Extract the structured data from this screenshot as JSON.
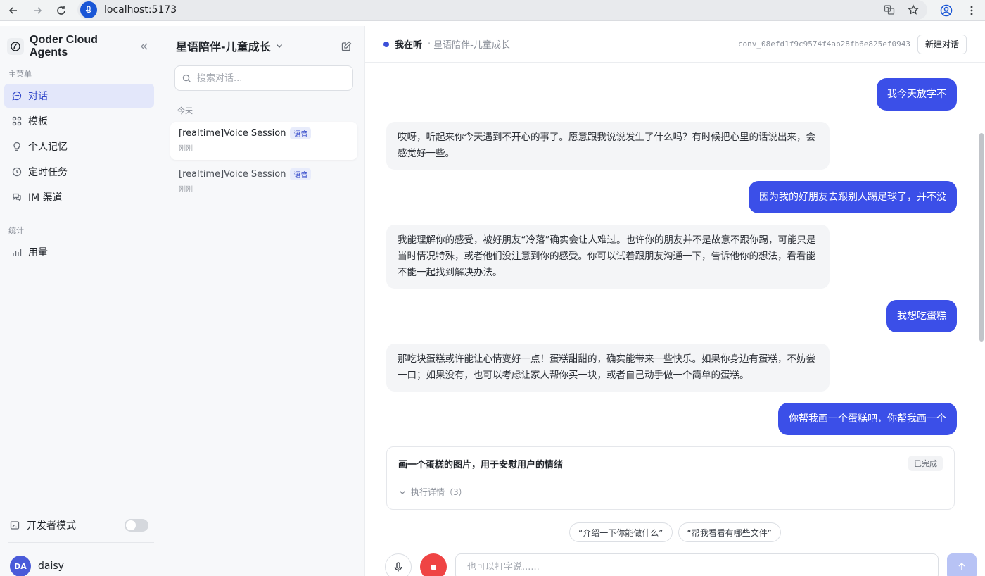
{
  "browser": {
    "url": "localhost:5173"
  },
  "sidebar": {
    "brand": "Qoder Cloud Agents",
    "main_menu_label": "主菜单",
    "items": [
      {
        "label": "对话"
      },
      {
        "label": "模板"
      },
      {
        "label": "个人记忆"
      },
      {
        "label": "定时任务"
      },
      {
        "label": "IM 渠道"
      }
    ],
    "stats_label": "统计",
    "stats_items": [
      {
        "label": "用量"
      }
    ],
    "dev_mode_label": "开发者模式",
    "user": {
      "initials": "DA",
      "name": "daisy"
    }
  },
  "convlist": {
    "title": "星语陪伴-儿童成长",
    "search_placeholder": "搜索对话...",
    "group_label": "今天",
    "items": [
      {
        "name": "[realtime]Voice Session",
        "tag": "语音",
        "time": "刚刚"
      },
      {
        "name": "[realtime]Voice Session",
        "tag": "语音",
        "time": "刚刚"
      }
    ]
  },
  "chat": {
    "status": "我在听",
    "separator": "·",
    "agent_name": "星语陪伴-儿童成长",
    "conversation_id": "conv_08efd1f9c9574f4ab28fb6e825ef0943",
    "new_chat_label": "新建对话",
    "messages": [
      {
        "role": "user",
        "text": "我今天放学不"
      },
      {
        "role": "ai",
        "text": "哎呀，听起来你今天遇到不开心的事了。愿意跟我说说发生了什么吗？有时候把心里的话说出来，会感觉好一些。"
      },
      {
        "role": "user",
        "text": "因为我的好朋友去跟别人踢足球了，并不没"
      },
      {
        "role": "ai",
        "text": "我能理解你的感受，被好朋友“冷落”确实会让人难过。也许你的朋友并不是故意不跟你踢，可能只是当时情况特殊，或者他们没注意到你的感受。你可以试着跟朋友沟通一下，告诉他你的想法，看看能不能一起找到解决办法。"
      },
      {
        "role": "user",
        "text": "我想吃蛋糕"
      },
      {
        "role": "ai",
        "text": "那吃块蛋糕或许能让心情变好一点！蛋糕甜甜的，确实能带来一些快乐。如果你身边有蛋糕，不妨尝一口；如果没有，也可以考虑让家人帮你买一块，或者自己动手做一个简单的蛋糕。"
      },
      {
        "role": "user",
        "text": "你帮我画一个蛋糕吧，你帮我画一个"
      }
    ],
    "task": {
      "title": "画一个蛋糕的图片，用于安慰用户的情绪",
      "status": "已完成",
      "details_label": "执行详情（3）"
    },
    "suggestions": [
      "“介绍一下你能做什么”",
      "“帮我看看有哪些文件”"
    ],
    "input_placeholder": "也可以打字说......"
  },
  "colors": {
    "accent": "#3b4fe8",
    "stop": "#ef4444",
    "active_menu_bg": "#e3e7fa"
  }
}
